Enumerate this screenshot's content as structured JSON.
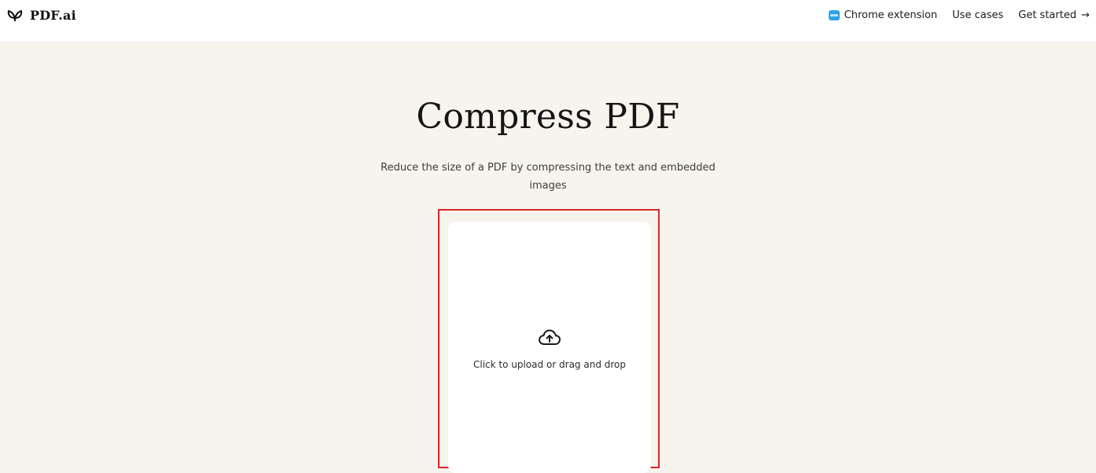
{
  "header": {
    "brand_name": "PDF.ai",
    "brand_icon": "pdfai-logo-icon",
    "nav": {
      "chrome_extension": "Chrome extension",
      "use_cases": "Use cases",
      "get_started": "Get started",
      "get_started_icon": "arrow-right-icon",
      "get_started_glyph": "→"
    }
  },
  "main": {
    "title": "Compress PDF",
    "subtitle": "Reduce the size of a PDF by compressing the text and embedded images"
  },
  "upload": {
    "label": "Click to upload or drag and drop",
    "icon": "cloud-upload-icon"
  },
  "colors": {
    "page_background": "#f7f4ee",
    "highlight_border": "#d9262a",
    "chrome_icon": "#2fa3e8"
  }
}
